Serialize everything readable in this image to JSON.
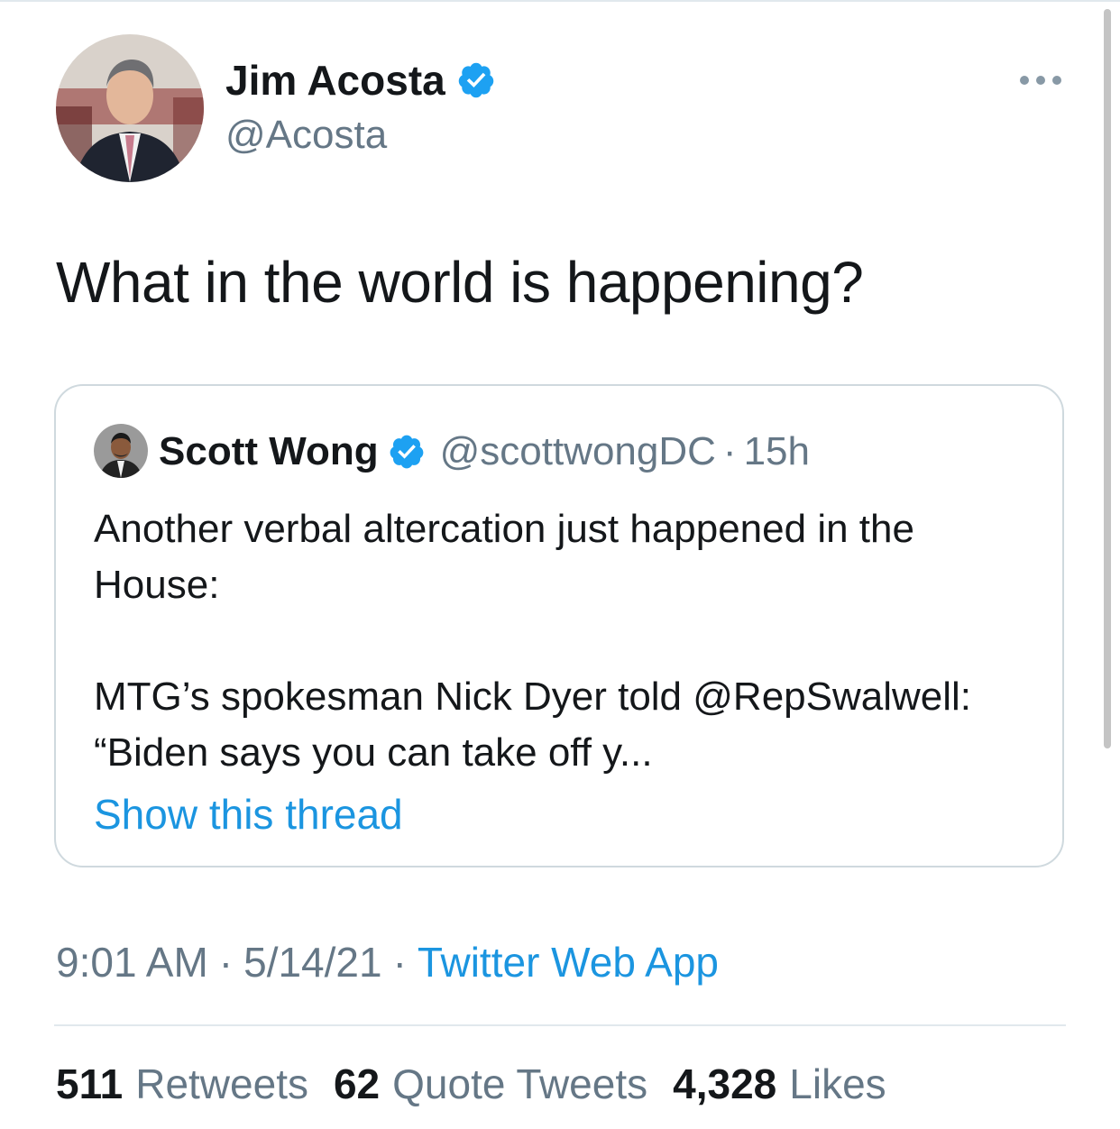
{
  "tweet": {
    "author": {
      "name": "Jim Acosta",
      "handle": "@Acosta",
      "verified": true,
      "avatar_icon": "profile-photo"
    },
    "more_icon": "more-horizontal-icon",
    "text": "What in the world is happening?",
    "quoted": {
      "author": {
        "name": "Scott Wong",
        "handle": "@scottwongDC",
        "verified": true
      },
      "separator": "·",
      "time": "15h",
      "text_lines": [
        "Another verbal altercation just happened in the House:",
        "MTG’s spokesman Nick Dyer told @RepSwalwell: “Biden says you can take off y..."
      ],
      "show_thread": "Show this thread"
    },
    "meta": {
      "time": "9:01 AM",
      "separator": "·",
      "date": "5/14/21",
      "source": "Twitter Web App"
    },
    "stats": {
      "retweets": {
        "count": "511",
        "label": "Retweets"
      },
      "quotes": {
        "count": "62",
        "label": "Quote Tweets"
      },
      "likes": {
        "count": "4,328",
        "label": "Likes"
      }
    }
  },
  "colors": {
    "text": "#14171a",
    "secondary": "#657786",
    "link": "#1b95e0",
    "verified": "#1da1f2",
    "border": "#cfd9de"
  }
}
